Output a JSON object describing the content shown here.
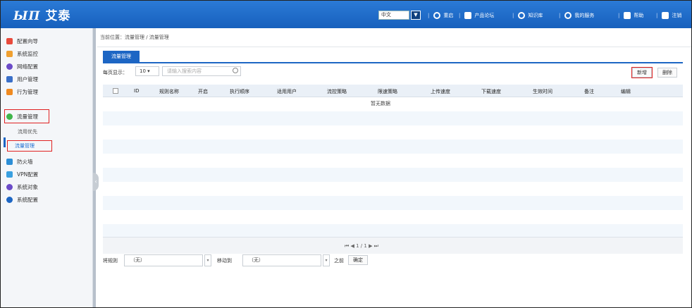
{
  "header": {
    "logo_mark": "ЫΠ",
    "logo_text": "艾泰",
    "language": "中文",
    "nav": [
      {
        "label": "重启",
        "icon": "power-icon"
      },
      {
        "label": "产品论坛",
        "icon": "forum-icon"
      },
      {
        "label": "知识库",
        "icon": "knowledge-icon"
      },
      {
        "label": "我的服务",
        "icon": "service-icon"
      },
      {
        "label": "帮助",
        "icon": "help-icon"
      },
      {
        "label": "注销",
        "icon": "logout-icon"
      }
    ]
  },
  "sidebar": {
    "items": [
      {
        "label": "配置向导",
        "color": "#e84a3c"
      },
      {
        "label": "系统监控",
        "color": "#f0a030"
      },
      {
        "label": "网络配置",
        "color": "#6b4bc8"
      },
      {
        "label": "用户管理",
        "color": "#3a6fc8"
      },
      {
        "label": "行为管理",
        "color": "#f08a20"
      },
      {
        "label": "流量管理",
        "color": "#3fb54a"
      },
      {
        "label": "流用优先",
        "color": ""
      },
      {
        "label": "流量管理",
        "color": ""
      },
      {
        "label": "防火墙",
        "color": "#2c8ed6"
      },
      {
        "label": "VPN配置",
        "color": "#3aa0e0"
      },
      {
        "label": "系统对象",
        "color": "#6b4bc8"
      },
      {
        "label": "系统配置",
        "color": "#1d66c4"
      }
    ]
  },
  "breadcrumb": {
    "text": "当前位置：流量管理 / 流量管理"
  },
  "tab": {
    "label": "流量管理"
  },
  "toolbar": {
    "per_page_label": "每页显示：",
    "per_page_value": "10",
    "search_placeholder": "请输入搜索内容",
    "new_label": "新增",
    "delete_label": "删除"
  },
  "table": {
    "columns": [
      "ID",
      "规则名称",
      "开启",
      "执行顺序",
      "适用用户",
      "流控策略",
      "限速策略",
      "上传速度",
      "下载速度",
      "生效时间",
      "备注",
      "编辑"
    ],
    "empty_text": "暂无数据"
  },
  "pager": {
    "text": "⏮ ◀ 1 / 1 ▶ ⏭"
  },
  "bottom": {
    "move_label": "将规则",
    "select1": "（无）",
    "move_to_label": "移动到",
    "select2": "（无）",
    "before_label": "之前",
    "confirm_label": "确定"
  }
}
